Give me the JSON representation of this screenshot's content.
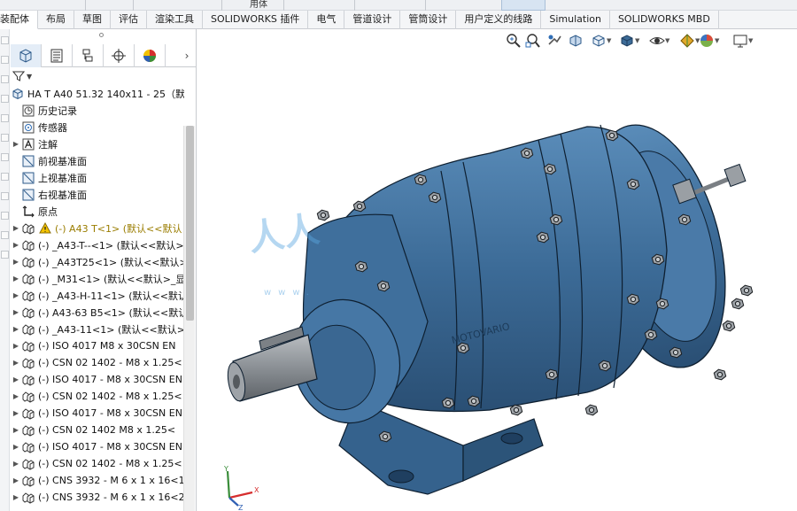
{
  "top_partial_tab": "用体",
  "command_tabs": [
    {
      "label": "装配体",
      "active": true
    },
    {
      "label": "布局"
    },
    {
      "label": "草图"
    },
    {
      "label": "评估"
    },
    {
      "label": "渲染工具"
    },
    {
      "label": "SOLIDWORKS 插件"
    },
    {
      "label": "电气"
    },
    {
      "label": "管道设计"
    },
    {
      "label": "管筒设计"
    },
    {
      "label": "用户定义的线路"
    },
    {
      "label": "Simulation"
    },
    {
      "label": "SOLIDWORKS MBD"
    }
  ],
  "feature_tree": {
    "root": "HA T A40 51.32 140x11 - 25（默认",
    "items": [
      {
        "label": "历史记录",
        "icon": "history-icon",
        "expand": false
      },
      {
        "label": "传感器",
        "icon": "sensor-icon",
        "expand": false
      },
      {
        "label": "注解",
        "icon": "annotation-icon",
        "expand": true
      },
      {
        "label": "前视基准面",
        "icon": "plane-icon",
        "expand": false
      },
      {
        "label": "上视基准面",
        "icon": "plane-icon",
        "expand": false
      },
      {
        "label": "右视基准面",
        "icon": "plane-icon",
        "expand": false
      },
      {
        "label": "原点",
        "icon": "origin-icon",
        "expand": false
      },
      {
        "label": "(-)  A43 T<1> (默认<<默认",
        "icon": "part-icon",
        "expand": true,
        "warning": true
      },
      {
        "label": "(-) _A43-T--<1> (默认<<默认>",
        "icon": "part-icon",
        "expand": true
      },
      {
        "label": "(-) _A43T25<1> (默认<<默认>_",
        "icon": "part-icon",
        "expand": true
      },
      {
        "label": "(-) _M31<1> (默认<<默认>_显",
        "icon": "part-icon",
        "expand": true
      },
      {
        "label": "(-) _A43-H-11<1> (默认<<默认",
        "icon": "part-icon",
        "expand": true
      },
      {
        "label": "(-) A43-63 B5<1> (默认<<默认",
        "icon": "part-icon",
        "expand": true
      },
      {
        "label": "(-) _A43-11<1> (默认<<默认>_",
        "icon": "part-icon",
        "expand": true
      },
      {
        "label": "(-) ISO 4017    M8 x 30CSN EN",
        "icon": "part-icon",
        "expand": true
      },
      {
        "label": "(-) CSN 02 1402 - M8 x 1.25<",
        "icon": "part-icon",
        "expand": true
      },
      {
        "label": "(-) ISO 4017 - M8 x 30CSN EN",
        "icon": "part-icon",
        "expand": true
      },
      {
        "label": "(-) CSN 02 1402 - M8 x 1.25<",
        "icon": "part-icon",
        "expand": true
      },
      {
        "label": "(-) ISO 4017 - M8 x 30CSN EN",
        "icon": "part-icon",
        "expand": true
      },
      {
        "label": "(-) CSN 02 1402    M8 x 1.25<",
        "icon": "part-icon",
        "expand": true
      },
      {
        "label": "(-) ISO 4017 - M8 x 30CSN EN",
        "icon": "part-icon",
        "expand": true
      },
      {
        "label": "(-) CSN 02 1402 - M8 x 1.25<",
        "icon": "part-icon",
        "expand": true
      },
      {
        "label": "(-) CNS 3932 - M 6 x 1 x 16<1",
        "icon": "part-icon",
        "expand": true
      },
      {
        "label": "(-) CNS 3932 - M 6 x 1 x 16<2",
        "icon": "part-icon",
        "expand": true
      }
    ]
  },
  "model": {
    "brand_text": "MOTOVARIO",
    "body_color": "#3c6b97",
    "body_dark": "#2b5177",
    "body_light": "#5586b3",
    "shaft_color": "#8a8f94"
  },
  "triad": {
    "x": "X",
    "y": "Y",
    "z": "Z"
  }
}
